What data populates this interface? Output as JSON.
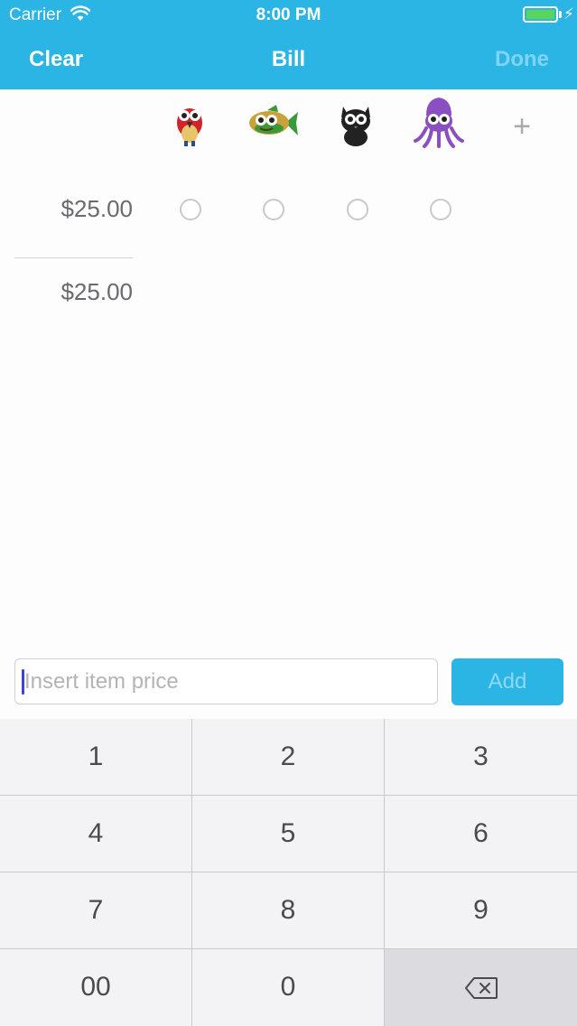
{
  "status_bar": {
    "carrier": "Carrier",
    "time": "8:00 PM"
  },
  "nav": {
    "left_label": "Clear",
    "title": "Bill",
    "right_label": "Done"
  },
  "people": [
    {
      "icon": "parrot-icon",
      "color": "#d0232a"
    },
    {
      "icon": "fish-icon",
      "color": "#3a9a3a"
    },
    {
      "icon": "cat-icon",
      "color": "#222222"
    },
    {
      "icon": "octopus-icon",
      "color": "#8a4fc0"
    }
  ],
  "add_person": {
    "icon": "plus-icon",
    "label": "+"
  },
  "items": [
    {
      "price": "$25.00",
      "assigned": [
        false,
        false,
        false,
        false
      ]
    }
  ],
  "total": {
    "price": "$25.00"
  },
  "entry": {
    "placeholder": "Insert item price",
    "value": "",
    "button_label": "Add"
  },
  "keypad": {
    "keys": [
      "1",
      "2",
      "3",
      "4",
      "5",
      "6",
      "7",
      "8",
      "9",
      "00",
      "0"
    ],
    "backspace_icon": "backspace-icon"
  },
  "colors": {
    "accent": "#2bb5e5",
    "done_disabled": "#7fd4f2"
  }
}
